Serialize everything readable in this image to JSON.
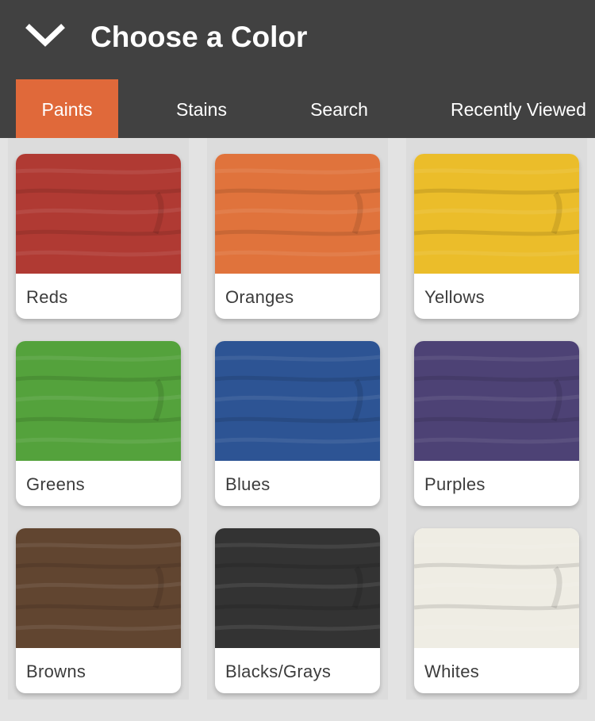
{
  "header": {
    "title": "Choose a Color",
    "back_icon": "chevron-down-icon"
  },
  "tabs": [
    {
      "label": "Paints",
      "active": true
    },
    {
      "label": "Stains",
      "active": false
    },
    {
      "label": "Search",
      "active": false
    },
    {
      "label": "Recently Viewed",
      "active": false
    }
  ],
  "accent_color": "#e0693a",
  "header_color": "#414141",
  "color_families": [
    {
      "label": "Reds",
      "color": "#b03a33"
    },
    {
      "label": "Oranges",
      "color": "#e0733c"
    },
    {
      "label": "Yellows",
      "color": "#ebbd2a"
    },
    {
      "label": "Greens",
      "color": "#54a23c"
    },
    {
      "label": "Blues",
      "color": "#2d5494"
    },
    {
      "label": "Purples",
      "color": "#4d4275"
    },
    {
      "label": "Browns",
      "color": "#614530"
    },
    {
      "label": "Blacks/Grays",
      "color": "#333333"
    },
    {
      "label": "Whites",
      "color": "#efede4"
    }
  ]
}
